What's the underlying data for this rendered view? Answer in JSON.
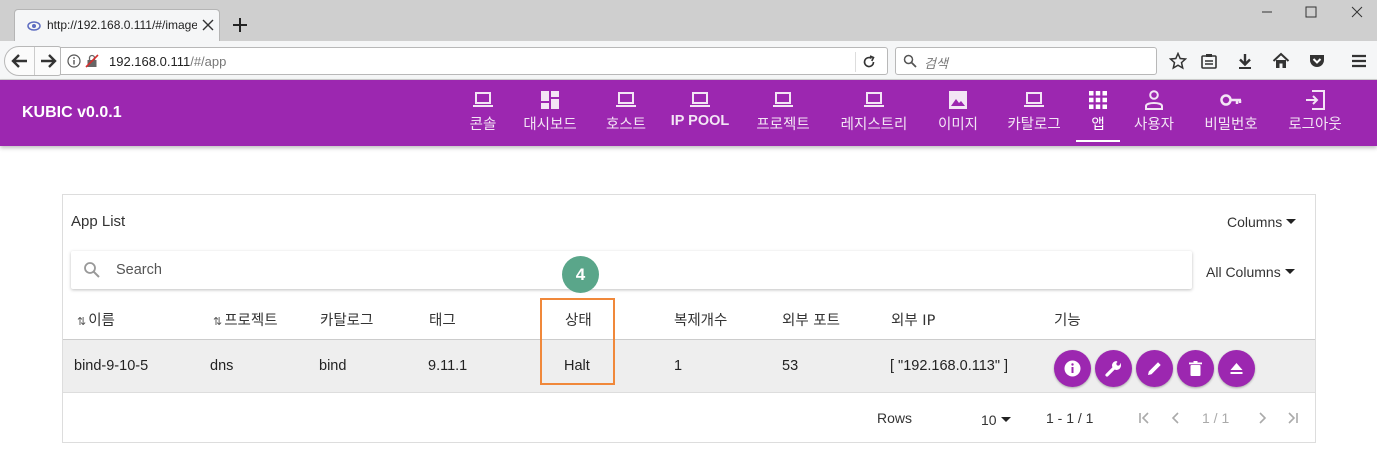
{
  "browser": {
    "tab_title": "http://192.168.0.111/#/image",
    "url_host": "192.168.0.111",
    "url_path": "/#/app",
    "search_placeholder": "검색"
  },
  "app": {
    "brand": "KUBIC v0.0.1",
    "nav": [
      {
        "label": "콘솔",
        "icon": "laptop-icon"
      },
      {
        "label": "대시보드",
        "icon": "dashboard-icon"
      },
      {
        "label": "호스트",
        "icon": "laptop-icon"
      },
      {
        "label": "IP POOL",
        "icon": "laptop-icon"
      },
      {
        "label": "프로젝트",
        "icon": "laptop-icon"
      },
      {
        "label": "레지스트리",
        "icon": "laptop-icon"
      },
      {
        "label": "이미지",
        "icon": "image-icon"
      },
      {
        "label": "카탈로그",
        "icon": "laptop-icon"
      },
      {
        "label": "앱",
        "icon": "apps-grid-icon",
        "active": true
      },
      {
        "label": "사용자",
        "icon": "person-icon"
      },
      {
        "label": "비밀번호",
        "icon": "key-icon"
      },
      {
        "label": "로그아웃",
        "icon": "exit-icon"
      }
    ],
    "accent_color": "#9c27b0"
  },
  "card": {
    "title": "App List",
    "columns_dropdown": "Columns",
    "all_columns_dropdown": "All Columns",
    "search_placeholder": "Search",
    "headers": [
      "이름",
      "프로젝트",
      "카탈로그",
      "태그",
      "상태",
      "복제개수",
      "외부 포트",
      "외부 IP",
      "기능"
    ],
    "rows": [
      {
        "name": "bind-9-10-5",
        "project": "dns",
        "catalog": "bind",
        "tag": "9.11.1",
        "status": "Halt",
        "replicas": "1",
        "external_port": "53",
        "external_ip": "[ \"192.168.0.113\" ]",
        "actions": [
          "info-icon",
          "wrench-icon",
          "edit-icon",
          "delete-icon",
          "eject-icon"
        ]
      }
    ],
    "footer": {
      "rows_label": "Rows",
      "rows_per_page": "10",
      "range": "1 - 1 / 1",
      "page_indicator": "1 / 1"
    }
  },
  "annotation": {
    "step_number": "4",
    "color": "#f0883a",
    "badge_color": "#5aa68a"
  }
}
